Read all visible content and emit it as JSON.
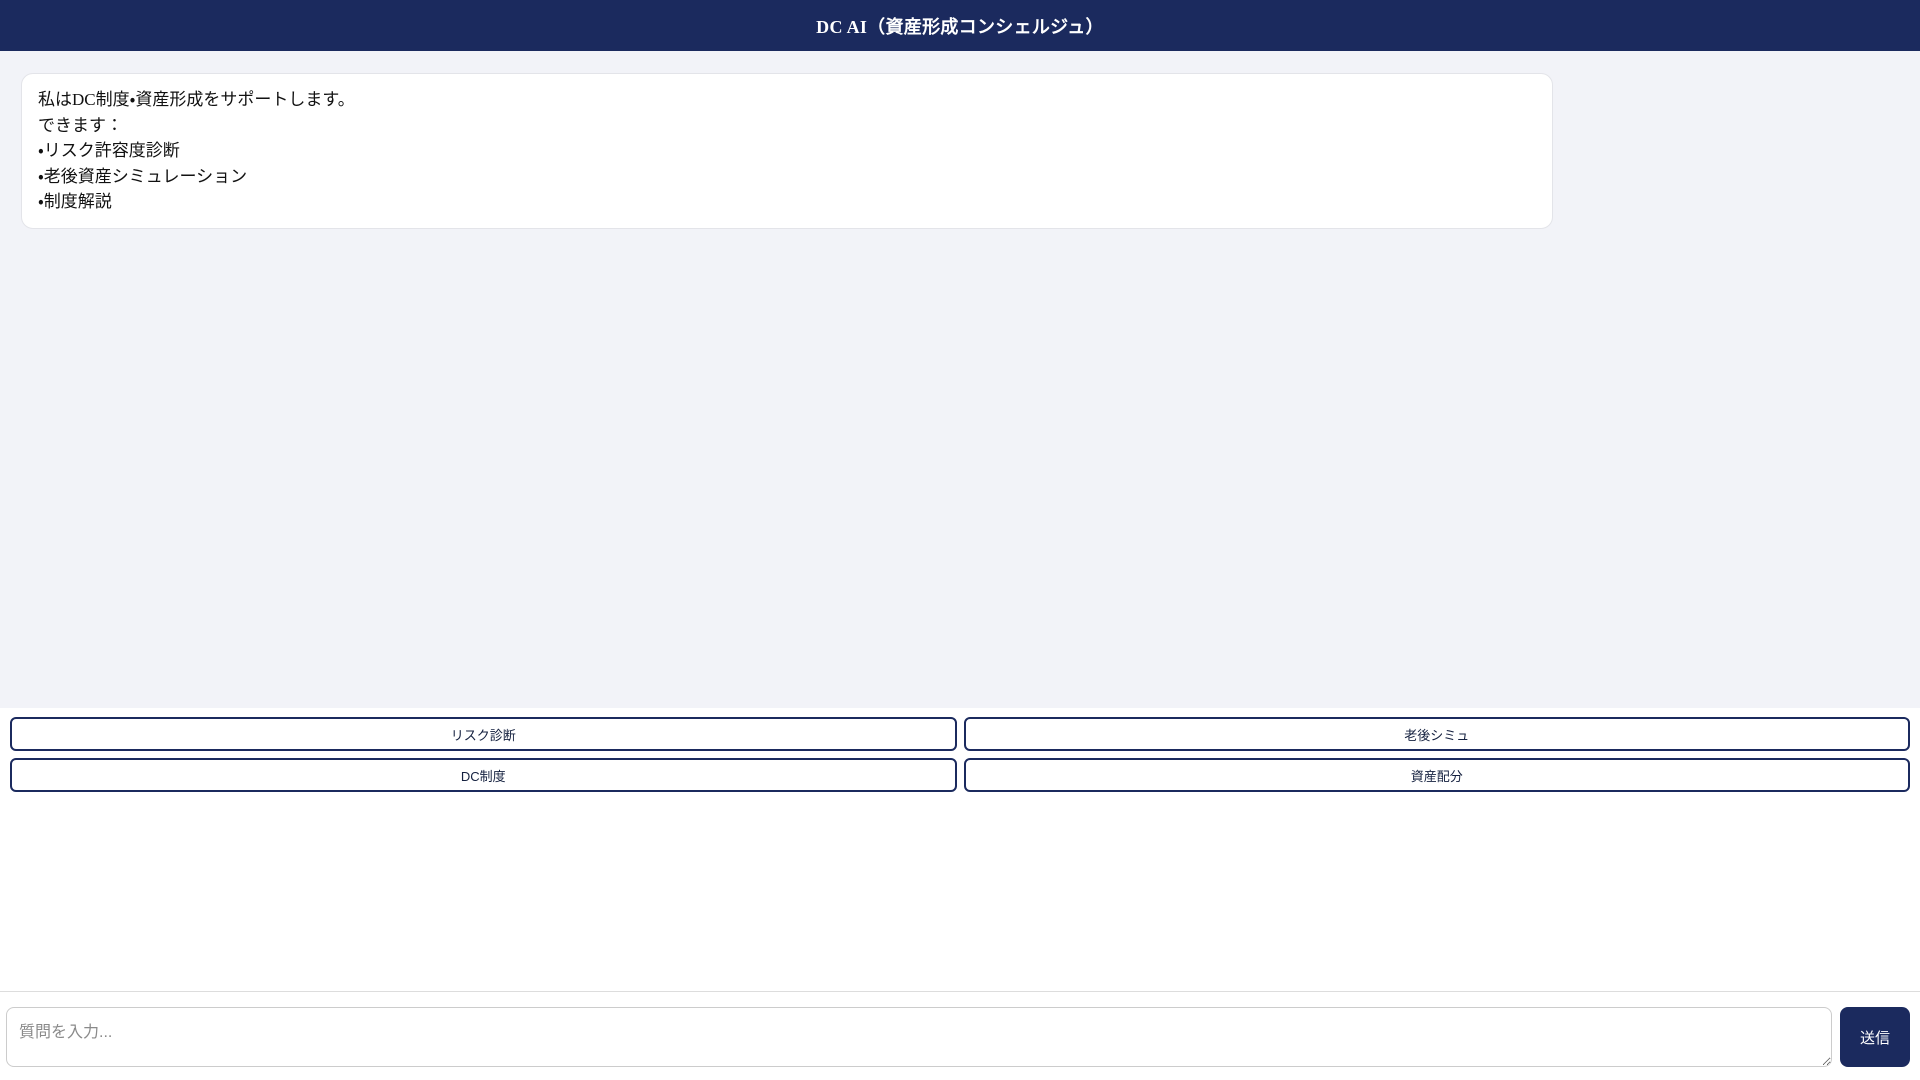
{
  "header": {
    "title": "DC AI（資産形成コンシェルジュ）"
  },
  "chat": {
    "assistant_message": "私はDC制度・資産形成をサポートします。\nできます：\n・リスク許容度診断\n・老後資産シミュレーション\n・制度解説"
  },
  "quick_actions": {
    "buttons": [
      {
        "id": "risk-diagnosis",
        "label": "リスク診断"
      },
      {
        "id": "retirement-simulation",
        "label": "老後シミュ"
      },
      {
        "id": "dc-system",
        "label": "DC制度"
      },
      {
        "id": "asset-allocation",
        "label": "資産配分"
      }
    ]
  },
  "composer": {
    "input_value": "",
    "input_placeholder": "質問を入力...",
    "send_label": "送信"
  },
  "colors": {
    "navy": "#1b2a5e",
    "chat_background": "#f2f3f8",
    "bubble_border": "#e3e4e9",
    "divider": "#dddddd"
  }
}
